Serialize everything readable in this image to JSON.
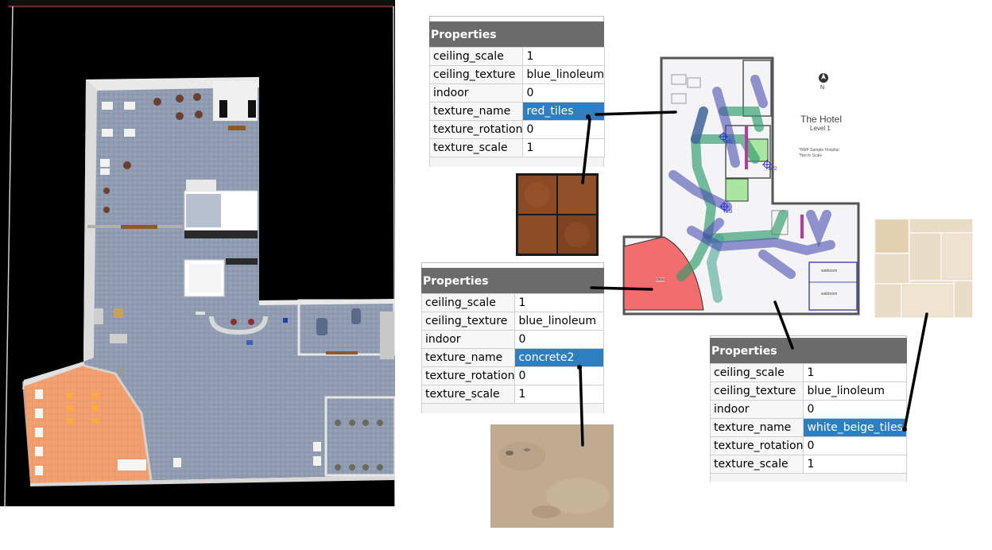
{
  "panels": {
    "red": {
      "title": "Properties",
      "rows": [
        {
          "key": "ceiling_scale",
          "value": "1"
        },
        {
          "key": "ceiling_texture",
          "value": "blue_linoleum"
        },
        {
          "key": "indoor",
          "value": "0"
        },
        {
          "key": "texture_name",
          "value": "red_tiles",
          "selected": true
        },
        {
          "key": "texture_rotation",
          "value": "0"
        },
        {
          "key": "texture_scale",
          "value": "1"
        }
      ]
    },
    "concrete": {
      "title": "Properties",
      "rows": [
        {
          "key": "ceiling_scale",
          "value": "1"
        },
        {
          "key": "ceiling_texture",
          "value": "blue_linoleum"
        },
        {
          "key": "indoor",
          "value": "0"
        },
        {
          "key": "texture_name",
          "value": "concrete2",
          "selected": true
        },
        {
          "key": "texture_rotation",
          "value": "0"
        },
        {
          "key": "texture_scale",
          "value": "1"
        }
      ]
    },
    "beige": {
      "title": "Properties",
      "rows": [
        {
          "key": "ceiling_scale",
          "value": "1"
        },
        {
          "key": "ceiling_texture",
          "value": "blue_linoleum"
        },
        {
          "key": "indoor",
          "value": "0"
        },
        {
          "key": "texture_name",
          "value": "white_beige_tiles",
          "selected": true
        },
        {
          "key": "texture_rotation",
          "value": "0"
        },
        {
          "key": "texture_scale",
          "value": "1"
        }
      ]
    }
  },
  "floorplan": {
    "title": "The Hotel",
    "level": "Level 1",
    "compass": "N",
    "notes": [
      "*RMF Sample Hospital",
      "*Not to Scale"
    ],
    "refs": [
      "ref1",
      "ref2",
      "ref3"
    ],
    "region_labels": [
      "choo",
      "waitroom",
      "waitroom"
    ]
  },
  "colors": {
    "selection": "#2f7ec0",
    "panel_header": "#6b6b6b",
    "red_floor": "#f26d6d",
    "lane_green": "#2e9a6a",
    "lane_blue": "#4a4fb0",
    "floor_blue_gray": "#8e9bb0",
    "orange_floor": "#f2a070"
  }
}
